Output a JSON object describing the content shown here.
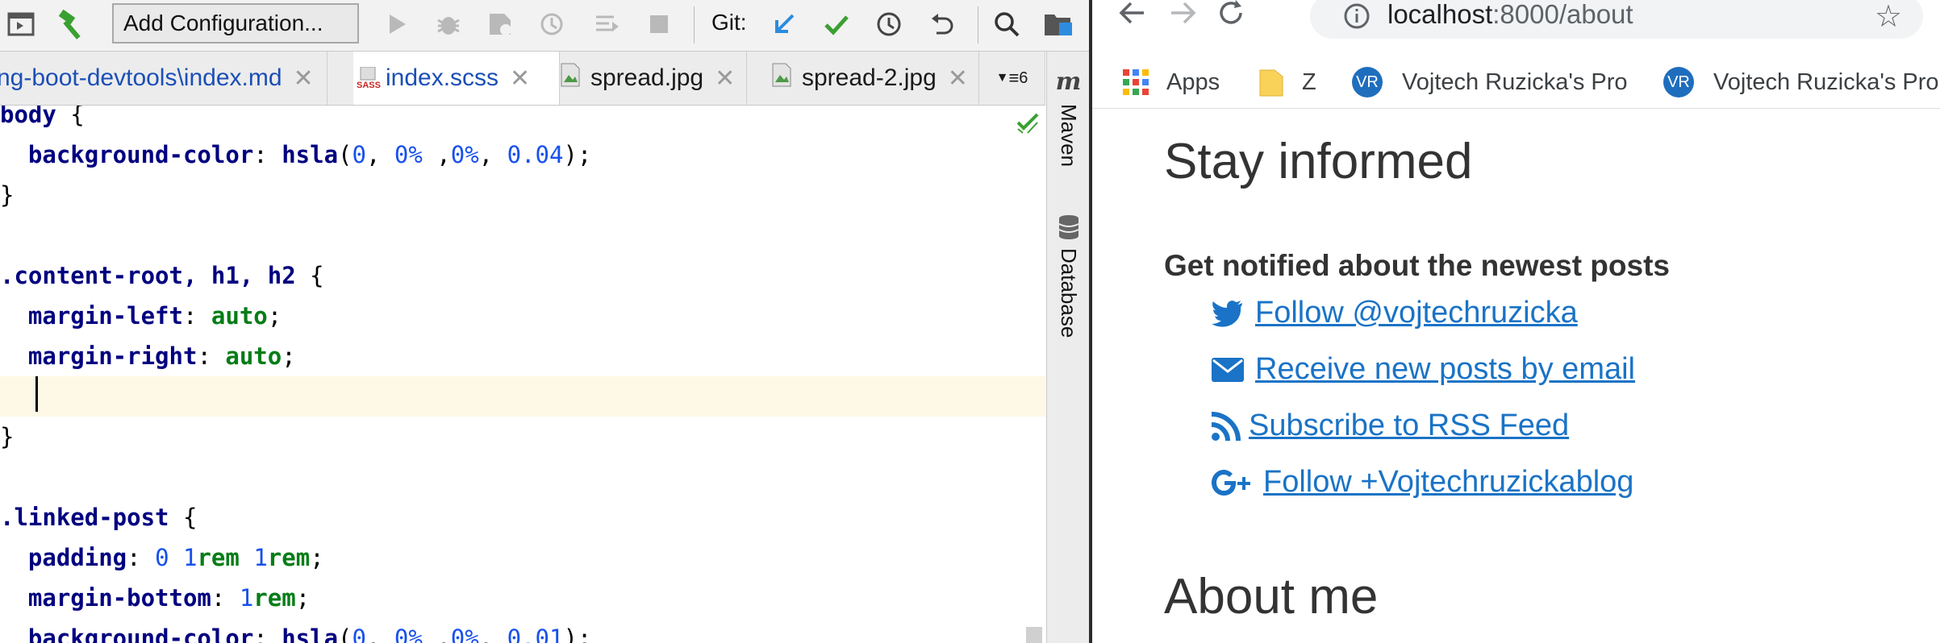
{
  "ide": {
    "toolbar": {
      "run_config": "Add Configuration...",
      "git_label": "Git:"
    },
    "tabs": [
      {
        "label": "ng-boot-devtools\\index.md",
        "active": false
      },
      {
        "label": "index.scss",
        "active": true,
        "badge": "SASS"
      },
      {
        "label": "spread.jpg",
        "active": false
      },
      {
        "label": "spread-2.jpg",
        "active": false
      }
    ],
    "tab_overflow_count": "6",
    "side_tabs": {
      "maven_icon": "m",
      "maven": "Maven",
      "database": "Database"
    },
    "code": {
      "l1_sel": "body",
      "l1_brace": " {",
      "l2_prop": "background-color",
      "l2_colon": ": ",
      "l2_fn": "hsla",
      "l2_a": "(",
      "l2_v1": "0",
      "l2_c1": ", ",
      "l2_v2": "0%",
      "l2_c2": " ,",
      "l2_v3": "0%",
      "l2_c3": ", ",
      "l2_v4": "0.04",
      "l2_end": ");",
      "l3": "}",
      "l5_sel": ".content-root, h1, h2",
      "l5_brace": " {",
      "l6_prop": "margin-left",
      "l6_colon": ": ",
      "l6_val": "auto",
      "l6_end": ";",
      "l7_prop": "margin-right",
      "l7_colon": ": ",
      "l7_val": "auto",
      "l7_end": ";",
      "l9": "}",
      "l11_sel": ".linked-post",
      "l11_brace": " {",
      "l12_prop": "padding",
      "l12_colon": ": ",
      "l12_v1": "0",
      "l12_s1": " ",
      "l12_v2": "1",
      "l12_u2": "rem",
      "l12_s2": " ",
      "l12_v3": "1",
      "l12_u3": "rem",
      "l12_end": ";",
      "l13_prop": "margin-bottom",
      "l13_colon": ": ",
      "l13_v": "1",
      "l13_u": "rem",
      "l13_end": ";",
      "l14_prop": "background-color",
      "l14_colon": ": ",
      "l14_fn": "hsla",
      "l14_a": "(",
      "l14_v1": "0",
      "l14_c1": ", ",
      "l14_v2": "0%",
      "l14_c2": " ,",
      "l14_v3": "0%",
      "l14_c3": ", ",
      "l14_v4": "0.01",
      "l14_end": ");"
    }
  },
  "browser": {
    "url_host": "localhost",
    "url_path": ":8000/about",
    "bookmarks": [
      {
        "label": "Apps"
      },
      {
        "label": "Z"
      },
      {
        "label": "Vojtech Ruzicka's Pro",
        "avatar": "VR"
      },
      {
        "label": "Vojtech Ruzicka's Pro",
        "avatar": "VR"
      }
    ],
    "page": {
      "heading": "Stay informed",
      "subheading": "Get notified about the newest posts",
      "links": [
        {
          "label": "Follow @vojtechruzicka",
          "icon": "twitter-icon"
        },
        {
          "label": "Receive new posts by email",
          "icon": "mail-icon"
        },
        {
          "label": "Subscribe to RSS Feed",
          "icon": "rss-icon"
        },
        {
          "label": "Follow +Vojtechruzickablog",
          "icon": "google-plus-icon"
        }
      ],
      "about_heading": "About me"
    }
  },
  "colors": {
    "link": "#1a73c6",
    "css_property": "#000080",
    "css_number": "#1750eb",
    "css_keyword": "#067d17",
    "current_line": "#fdf9e6"
  }
}
